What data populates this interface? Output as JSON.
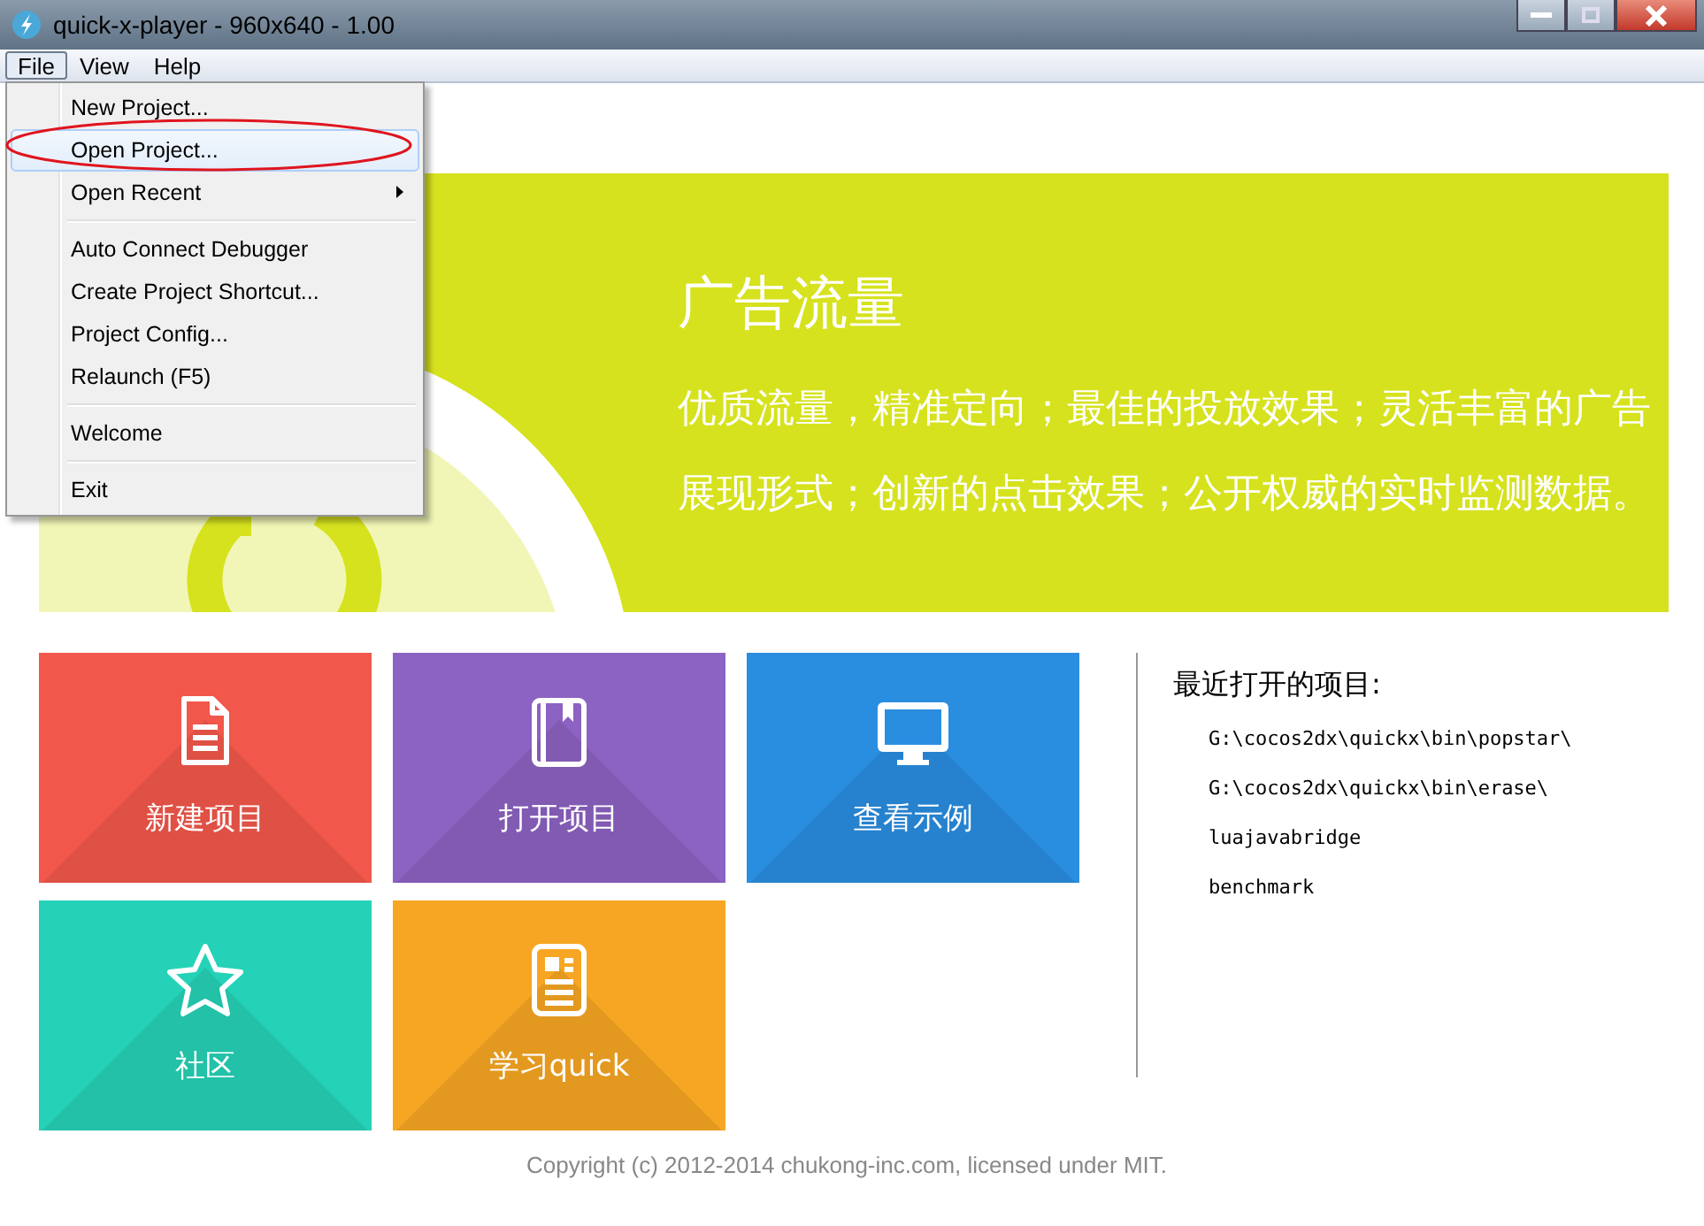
{
  "window": {
    "title": "quick-x-player - 960x640 - 1.00"
  },
  "menubar": [
    {
      "label": "File",
      "selected": true
    },
    {
      "label": "View",
      "selected": false
    },
    {
      "label": "Help",
      "selected": false
    }
  ],
  "file_menu": [
    {
      "kind": "item",
      "label": "New Project...",
      "selected": false
    },
    {
      "kind": "item",
      "label": "Open Project...",
      "selected": true
    },
    {
      "kind": "submenu",
      "label": "Open Recent",
      "selected": false
    },
    {
      "kind": "separator"
    },
    {
      "kind": "item",
      "label": "Auto Connect Debugger",
      "selected": false
    },
    {
      "kind": "item",
      "label": "Create Project Shortcut...",
      "selected": false
    },
    {
      "kind": "item",
      "label": "Project Config...",
      "selected": false
    },
    {
      "kind": "item",
      "label": "Relaunch (F5)",
      "selected": false
    },
    {
      "kind": "separator"
    },
    {
      "kind": "item",
      "label": "Welcome",
      "selected": false
    },
    {
      "kind": "separator"
    },
    {
      "kind": "item",
      "label": "Exit",
      "selected": false
    }
  ],
  "banner": {
    "title": "广告流量",
    "lines": [
      "优质流量，精准定向；最佳的投放效果；灵活丰富的广告",
      "展现形式；创新的点击效果；公开权威的实时监测数据。"
    ]
  },
  "tiles": [
    {
      "label": "新建项目",
      "kind": "document",
      "color": "#f2574b"
    },
    {
      "label": "打开项目",
      "kind": "notebook",
      "color": "#8c62c2"
    },
    {
      "label": "查看示例",
      "kind": "monitor",
      "color": "#2a8ee0"
    },
    {
      "label": "社区",
      "kind": "star",
      "color": "#25d2b7"
    },
    {
      "label": "学习quick",
      "kind": "article",
      "color": "#f7a623"
    }
  ],
  "recent": {
    "heading": "最近打开的项目:",
    "items": [
      "G:\\cocos2dx\\quickx\\bin\\popstar\\",
      "G:\\cocos2dx\\quickx\\bin\\erase\\",
      "luajavabridge",
      "benchmark"
    ]
  },
  "footer": "Copyright (c) 2012-2014 chukong-inc.com, licensed under MIT."
}
